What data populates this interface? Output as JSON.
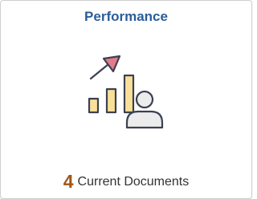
{
  "tile": {
    "title": "Performance",
    "count": "4",
    "count_label": "Current Documents"
  },
  "icons": {
    "main": "performance-chart-person-icon"
  },
  "colors": {
    "title": "#2a5d9a",
    "count": "#a0561a",
    "bar_fill": "#f9e09a",
    "arrow_fill": "#e27b8a",
    "stroke": "#3c4150",
    "person_fill": "#ececec"
  }
}
